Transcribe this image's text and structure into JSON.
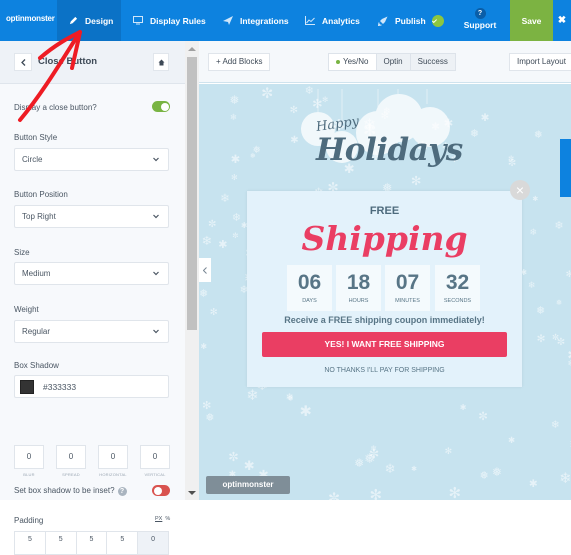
{
  "topnav": {
    "logo": "optinmonster",
    "items": [
      {
        "label": "Design",
        "icon": "pencil-icon",
        "active": true
      },
      {
        "label": "Display Rules",
        "icon": "monitor-icon"
      },
      {
        "label": "Integrations",
        "icon": "paper-plane-icon"
      },
      {
        "label": "Analytics",
        "icon": "line-chart-icon"
      },
      {
        "label": "Publish",
        "icon": "rocket-icon",
        "status": "check-icon"
      }
    ],
    "support_label": "Support",
    "support_icon": "?",
    "save_label": "Save",
    "close_glyph": "✖"
  },
  "panel": {
    "title": "Close Button",
    "display_close_label": "Display a close button?",
    "display_close_on": true,
    "fields": [
      {
        "label": "Button Style",
        "value": "Circle"
      },
      {
        "label": "Button Position",
        "value": "Top Right"
      },
      {
        "label": "Size",
        "value": "Medium"
      },
      {
        "label": "Weight",
        "value": "Regular"
      }
    ],
    "box_shadow": {
      "label": "Box Shadow",
      "color": "#333333",
      "values": [
        {
          "value": "0",
          "label": "BLUR"
        },
        {
          "value": "0",
          "label": "SPREAD"
        },
        {
          "value": "0",
          "label": "HORIZONTAL"
        },
        {
          "value": "0",
          "label": "VERTICAL"
        }
      ],
      "inset_label": "Set box shadow to be inset?",
      "inset_on": false
    },
    "padding": {
      "label": "Padding",
      "unit_px": "PX",
      "unit_pct": "%",
      "values": [
        "5",
        "5",
        "5",
        "5",
        "0"
      ]
    }
  },
  "toolbar": {
    "add_blocks": "+ Add Blocks",
    "views": [
      {
        "label": "Yes/No",
        "active": true
      },
      {
        "label": "Optin",
        "active": false
      },
      {
        "label": "Success",
        "active": false
      }
    ],
    "import_layout": "Import Layout"
  },
  "campaign": {
    "happy": "Happy",
    "holidays": "Holidays",
    "free": "FREE",
    "shipping": "Shipping",
    "countdown": [
      {
        "value": "06",
        "unit": "DAYS"
      },
      {
        "value": "18",
        "unit": "HOURS"
      },
      {
        "value": "07",
        "unit": "MINUTES"
      },
      {
        "value": "32",
        "unit": "SECONDS"
      }
    ],
    "receive_text": "Receive a FREE shipping coupon immediately!",
    "cta_label": "YES! I WANT FREE SHIPPING",
    "decline_label": "NO THANKS I'LL PAY FOR SHIPPING",
    "close_glyph": "×",
    "badge": "optinmonster"
  },
  "colors": {
    "nav_blue": "#0d82df",
    "save_green": "#7cb342",
    "accent_pink": "#ea3e63",
    "text_slate": "#4e6b7d",
    "toggle_on": "#79b443",
    "toggle_off": "#d9534f"
  }
}
